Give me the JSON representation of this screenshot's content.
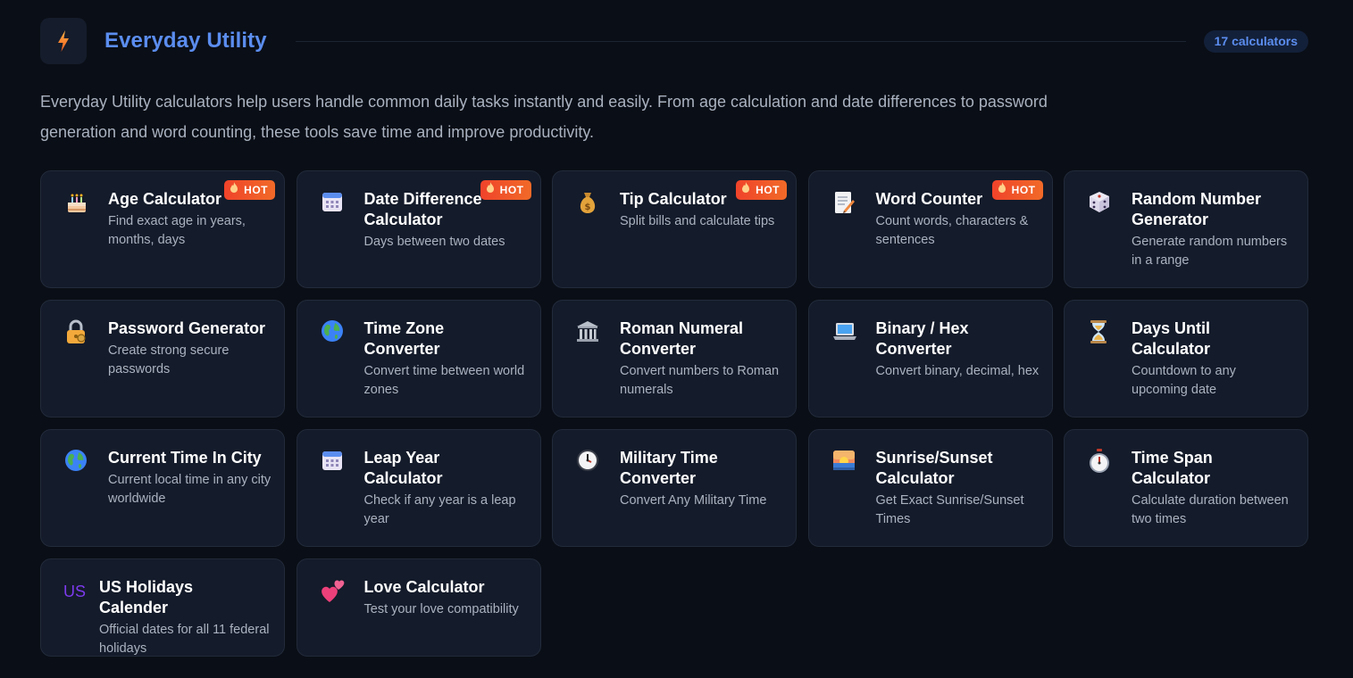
{
  "header": {
    "title": "Everyday Utility",
    "count_label": "17 calculators",
    "accent_color": "#5b8def",
    "icon": "lightning-bolt-icon"
  },
  "description": "Everyday Utility calculators help users handle common daily tasks instantly and easily. From age calculation and date differences to password generation and word counting, these tools save time and improve productivity.",
  "hot_label": "HOT",
  "calculators": [
    {
      "name": "Age Calculator",
      "desc": "Find exact age in years, months, days",
      "icon": "cake-icon",
      "hot": true
    },
    {
      "name": "Date Difference Calculator",
      "desc": "Days between two dates",
      "icon": "calendar-icon",
      "hot": true
    },
    {
      "name": "Tip Calculator",
      "desc": "Split bills and calculate tips",
      "icon": "money-bag-icon",
      "hot": true
    },
    {
      "name": "Word Counter",
      "desc": "Count words, characters & sentences",
      "icon": "memo-icon",
      "hot": true
    },
    {
      "name": "Random Number Generator",
      "desc": "Generate random numbers in a range",
      "icon": "dice-icon",
      "hot": false
    },
    {
      "name": "Password Generator",
      "desc": "Create strong secure passwords",
      "icon": "lock-key-icon",
      "hot": false
    },
    {
      "name": "Time Zone Converter",
      "desc": "Convert time between world zones",
      "icon": "globe-icon",
      "hot": false
    },
    {
      "name": "Roman Numeral Converter",
      "desc": "Convert numbers to Roman numerals",
      "icon": "classical-building-icon",
      "hot": false
    },
    {
      "name": "Binary / Hex Converter",
      "desc": "Convert binary, decimal, hex",
      "icon": "laptop-icon",
      "hot": false
    },
    {
      "name": "Days Until Calculator",
      "desc": "Countdown to any upcoming date",
      "icon": "hourglass-icon",
      "hot": false
    },
    {
      "name": "Current Time In City",
      "desc": "Current local time in any city worldwide",
      "icon": "globe-icon",
      "hot": false
    },
    {
      "name": "Leap Year Calculator",
      "desc": "Check if any year is a leap year",
      "icon": "calendar-icon",
      "hot": false
    },
    {
      "name": "Military Time Converter",
      "desc": "Convert Any Military Time",
      "icon": "clock-icon",
      "hot": false
    },
    {
      "name": "Sunrise/Sunset Calculator",
      "desc": "Get Exact Sunrise/Sunset Times",
      "icon": "sunrise-icon",
      "hot": false
    },
    {
      "name": "Time Span Calculator",
      "desc": "Calculate duration between two times",
      "icon": "stopwatch-icon",
      "hot": false
    },
    {
      "name": "US Holidays Calender",
      "desc": "Official dates for all 11 federal holidays",
      "icon": "us-flag-icon",
      "icon_text": "US",
      "hot": false
    },
    {
      "name": "Love Calculator",
      "desc": "Test your love compatibility",
      "icon": "two-hearts-icon",
      "hot": false
    }
  ]
}
